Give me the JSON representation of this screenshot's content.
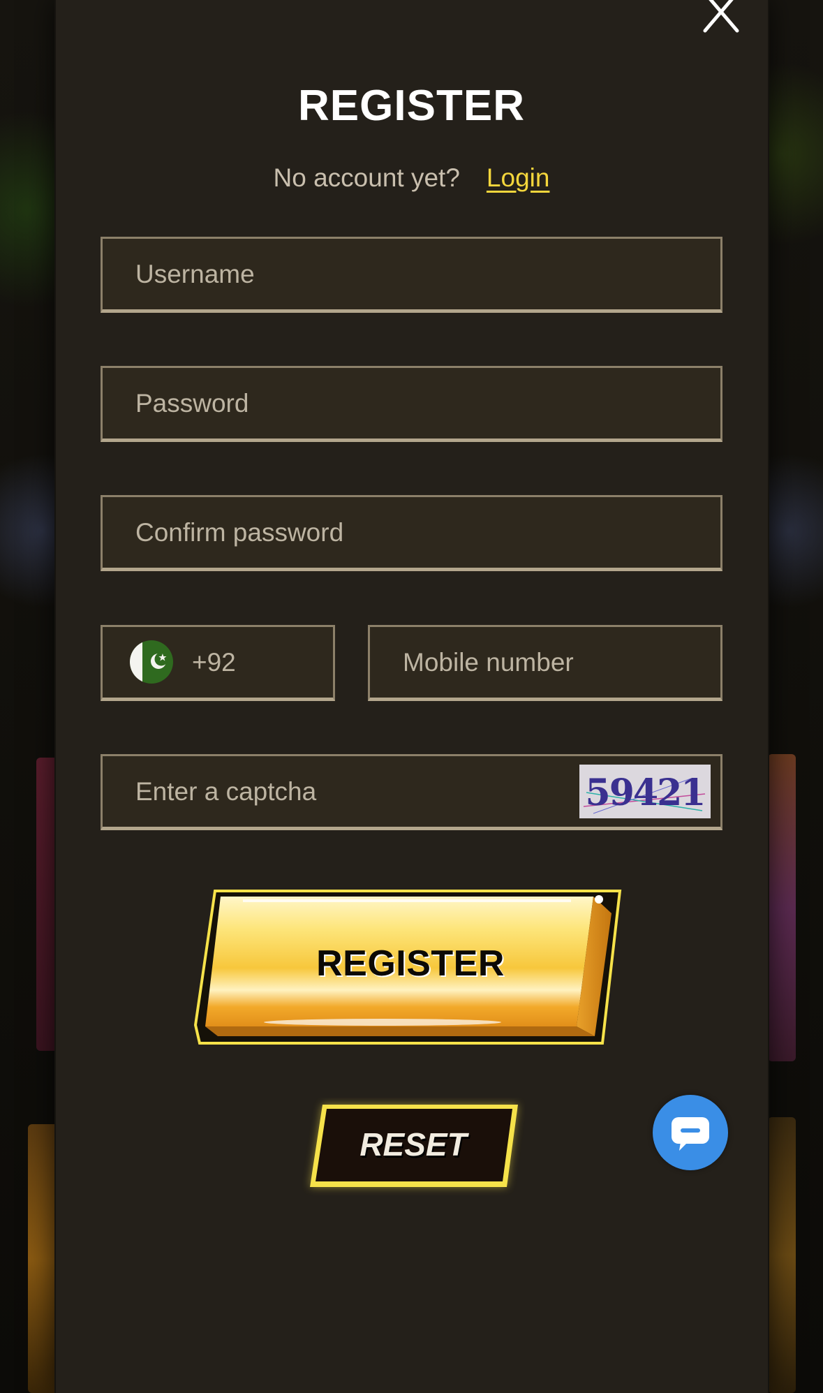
{
  "modal": {
    "title": "REGISTER",
    "subtitle_text": "No account yet?",
    "login_link": "Login"
  },
  "form": {
    "username_placeholder": "Username",
    "password_placeholder": "Password",
    "confirm_password_placeholder": "Confirm password",
    "country_code": "+92",
    "mobile_placeholder": "Mobile number",
    "captcha_placeholder": "Enter a captcha",
    "captcha_value": "59421"
  },
  "buttons": {
    "register_label": "REGISTER",
    "reset_label": "RESET"
  },
  "icons": {
    "close": "close-icon",
    "flag": "pakistan-flag-icon",
    "chat": "chat-icon"
  },
  "colors": {
    "accent_yellow": "#f4d63c",
    "modal_bg": "#24201a",
    "chat_blue": "#3a8ee6"
  }
}
